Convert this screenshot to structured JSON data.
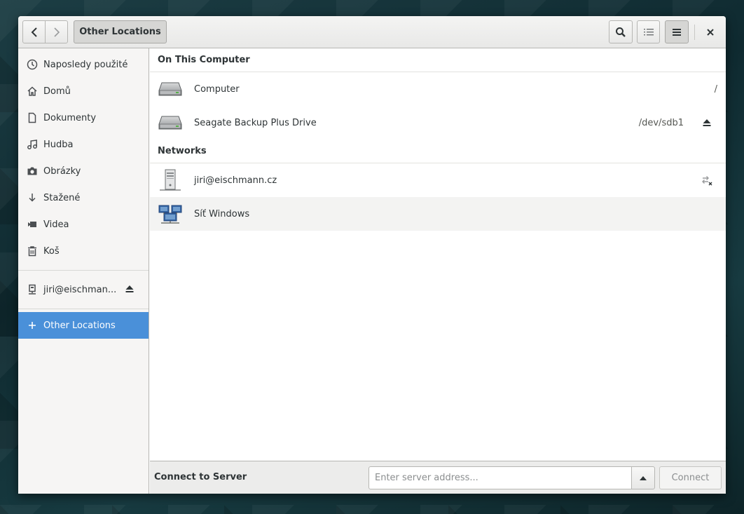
{
  "header": {
    "path_label": "Other Locations"
  },
  "sidebar": {
    "items": [
      {
        "label": "Naposledy použité",
        "icon": "clock-icon"
      },
      {
        "label": "Domů",
        "icon": "home-icon"
      },
      {
        "label": "Dokumenty",
        "icon": "document-icon"
      },
      {
        "label": "Hudba",
        "icon": "music-icon"
      },
      {
        "label": "Obrázky",
        "icon": "camera-icon"
      },
      {
        "label": "Stažené",
        "icon": "download-icon"
      },
      {
        "label": "Videa",
        "icon": "video-icon"
      },
      {
        "label": "Koš",
        "icon": "trash-icon"
      }
    ],
    "network_mount": {
      "label": "jiri@eischman...",
      "icon": "network-server-icon"
    },
    "other_locations": {
      "label": "Other Locations",
      "icon": "plus-icon"
    }
  },
  "main": {
    "sections": [
      {
        "title": "On This Computer",
        "rows": [
          {
            "label": "Computer",
            "path": "/",
            "icon": "drive-harddisk-icon"
          },
          {
            "label": "Seagate Backup Plus Drive",
            "path": "/dev/sdb1",
            "icon": "drive-harddisk-icon"
          }
        ]
      },
      {
        "title": "Networks",
        "rows": [
          {
            "label": "jiri@eischmann.cz",
            "icon": "network-server-icon"
          },
          {
            "label": "Síť Windows",
            "icon": "network-workgroup-icon"
          }
        ]
      }
    ]
  },
  "footer": {
    "label": "Connect to Server",
    "server_placeholder": "Enter server address...",
    "connect_label": "Connect"
  },
  "colors": {
    "accent": "#4a90d9",
    "sidebar_bg": "#f6f5f4"
  }
}
